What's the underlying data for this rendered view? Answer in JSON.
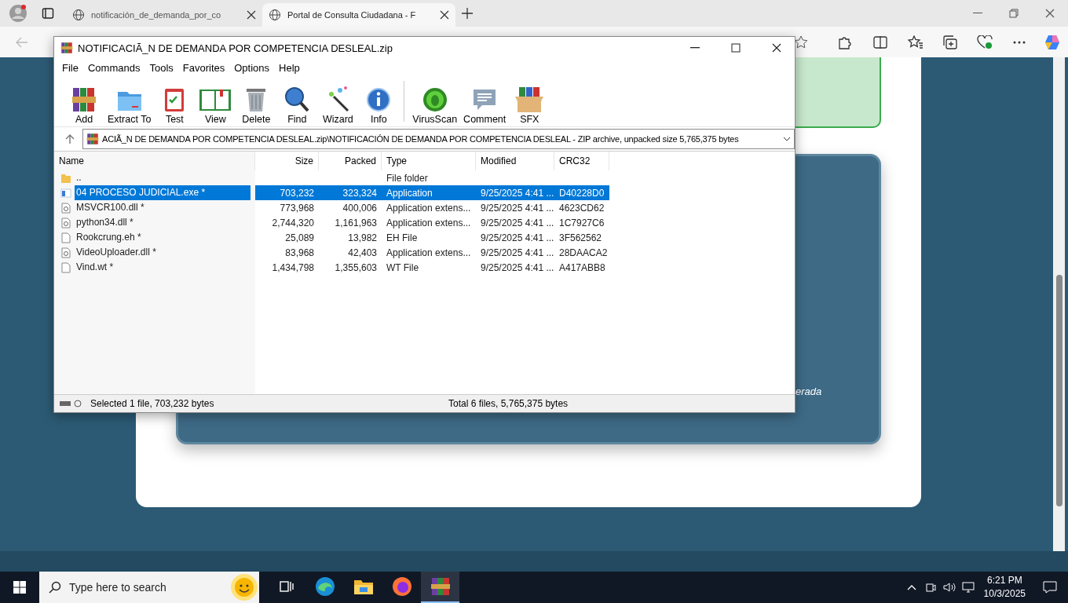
{
  "browser": {
    "tabs": [
      {
        "title": "notificación_de_demanda_por_co",
        "selected": false
      },
      {
        "title": "Portal de Consulta Ciudadana - F",
        "selected": true
      }
    ],
    "page": {
      "caption": "erada"
    }
  },
  "archiver": {
    "title": "NOTIFICACIÃ_N DE DEMANDA POR COMPETENCIA DESLEAL.zip",
    "menu": [
      "File",
      "Commands",
      "Tools",
      "Favorites",
      "Options",
      "Help"
    ],
    "toolbar": [
      {
        "kind": "add",
        "label": "Add"
      },
      {
        "kind": "extract",
        "label": "Extract To"
      },
      {
        "kind": "test",
        "label": "Test"
      },
      {
        "kind": "view",
        "label": "View"
      },
      {
        "kind": "delete",
        "label": "Delete"
      },
      {
        "kind": "find",
        "label": "Find"
      },
      {
        "kind": "wizard",
        "label": "Wizard"
      },
      {
        "kind": "info",
        "label": "Info"
      },
      {
        "kind": "virus",
        "label": "VirusScan"
      },
      {
        "kind": "comment",
        "label": "Comment"
      },
      {
        "kind": "sfx",
        "label": "SFX"
      }
    ],
    "path": "ACIÃ_N DE DEMANDA POR COMPETENCIA DESLEAL.zip\\NOTIFICACIÓN DE DEMANDA POR COMPETENCIA DESLEAL - ZIP archive, unpacked size 5,765,375 bytes",
    "columns": [
      "Name",
      "Size",
      "Packed",
      "Type",
      "Modified",
      "CRC32"
    ],
    "rows": [
      {
        "kind": "folder",
        "cells": [
          "..",
          "",
          "",
          "File folder",
          "",
          ""
        ],
        "selected": false
      },
      {
        "kind": "exe",
        "cells": [
          "04 PROCESO JUDICIAL.exe *",
          "703,232",
          "323,324",
          "Application",
          "9/25/2025 4:41 ...",
          "D40228D0"
        ],
        "selected": true
      },
      {
        "kind": "dll",
        "cells": [
          "MSVCR100.dll *",
          "773,968",
          "400,006",
          "Application extens...",
          "9/25/2025 4:41 ...",
          "4623CD62"
        ],
        "selected": false
      },
      {
        "kind": "dll",
        "cells": [
          "python34.dll *",
          "2,744,320",
          "1,161,963",
          "Application extens...",
          "9/25/2025 4:41 ...",
          "1C7927C6"
        ],
        "selected": false
      },
      {
        "kind": "file",
        "cells": [
          "Rookcrung.eh *",
          "25,089",
          "13,982",
          "EH File",
          "9/25/2025 4:41 ...",
          "3F562562"
        ],
        "selected": false
      },
      {
        "kind": "dll",
        "cells": [
          "VideoUploader.dll *",
          "83,968",
          "42,403",
          "Application extens...",
          "9/25/2025 4:41 ...",
          "28DAACA2"
        ],
        "selected": false
      },
      {
        "kind": "file",
        "cells": [
          "Vind.wt *",
          "1,434,798",
          "1,355,603",
          "WT File",
          "9/25/2025 4:41 ...",
          "A417ABB8"
        ],
        "selected": false
      }
    ],
    "status": {
      "selection": "Selected 1 file, 703,232 bytes",
      "total": "Total 6 files, 5,765,375 bytes"
    }
  },
  "taskbar": {
    "search_placeholder": "Type here to search",
    "apps": [
      {
        "kind": "taskview",
        "selected": false
      },
      {
        "kind": "edge",
        "selected": false
      },
      {
        "kind": "explorer",
        "selected": false
      },
      {
        "kind": "firefox",
        "selected": false
      },
      {
        "kind": "archiver",
        "selected": true
      }
    ],
    "time": "6:21 PM",
    "date": "10/3/2025"
  }
}
